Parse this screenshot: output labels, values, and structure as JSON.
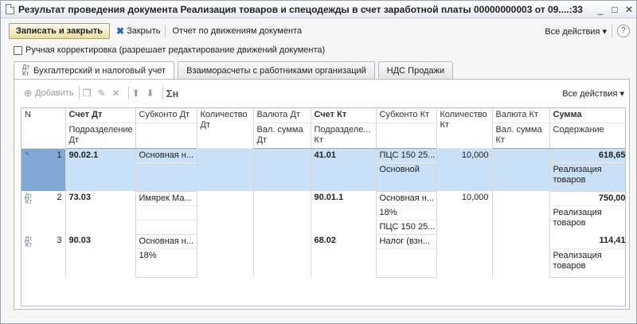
{
  "window": {
    "title": "Результат проведения документа Реализация товаров и спецодежды в счет заработной платы 00000000003 от 09....:33",
    "minimize": "_",
    "maximize": "□",
    "close": "✕"
  },
  "toolbar": {
    "save_close": "Записать и закрыть",
    "close": "Закрыть",
    "report": "Отчет по движениям документа",
    "all_actions": "Все действия ▾",
    "help": "?"
  },
  "manual_correction": "Ручная корректировка (разрешает редактирование движений документа)",
  "tabs": [
    {
      "label": "Бухгалтерский и налоговый учет"
    },
    {
      "label": "Взаиморасчеты с работниками организаций"
    },
    {
      "label": "НДС Продажи"
    }
  ],
  "tab_icon": "Дт\nКт",
  "table_toolbar": {
    "add": "Добавить",
    "sum": "Σн",
    "all_actions": "Все действия ▾"
  },
  "columns": {
    "n": "N",
    "schet_dt": "Счет Дт",
    "subkonto_dt": "Субконто Дт",
    "qty_dt": "Количество Дт",
    "val_dt": "Валюта Дт",
    "schet_kt": "Счет Кт",
    "subkonto_kt": "Субконто Кт",
    "qty_kt": "Количество Кт",
    "val_kt": "Валюта Кт",
    "summa": "Сумма",
    "podr_dt": "Подразделение Дт",
    "valsum_dt": "Вал. сумма Дт",
    "podr_kt": "Подразделе... Кт",
    "valsum_kt": "Вал. сумма Кт",
    "content": "Содержание"
  },
  "rows": [
    {
      "n": "1",
      "schet_dt": "90.02.1",
      "subkonto_dt": [
        "Основная н...",
        ""
      ],
      "schet_kt": "41.01",
      "subkonto_kt": [
        "ПЦС 150 25...",
        "Основной"
      ],
      "qty_kt": "10,000",
      "summa": "618,65",
      "content": "Реализация товаров"
    },
    {
      "n": "2",
      "schet_dt": "73.03",
      "subkonto_dt": [
        "Имярек Ма...",
        "",
        ""
      ],
      "schet_kt": "90.01.1",
      "subkonto_kt": [
        "Основная н...",
        "18%",
        "ПЦС 150 25..."
      ],
      "qty_kt": "10,000",
      "summa": "750,00",
      "content": "Реализация товаров"
    },
    {
      "n": "3",
      "schet_dt": "90.03",
      "subkonto_dt": [
        "Основная н...",
        "18%"
      ],
      "schet_kt": "68.02",
      "subkonto_kt": [
        "Налог (взн...",
        ""
      ],
      "qty_kt": "",
      "summa": "114,41",
      "content": "Реализация товаров"
    }
  ]
}
